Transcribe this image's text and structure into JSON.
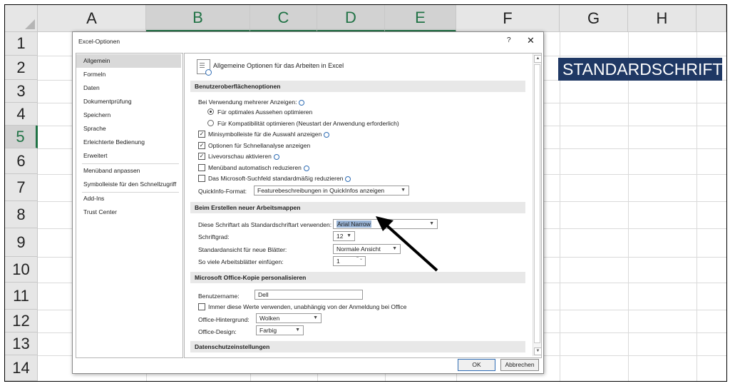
{
  "spreadsheet": {
    "columns": [
      "A",
      "B",
      "C",
      "D",
      "E",
      "F",
      "G",
      "H"
    ],
    "rows": [
      "1",
      "2",
      "3",
      "4",
      "5",
      "6",
      "7",
      "8",
      "9",
      "10",
      "11",
      "12",
      "13",
      "14"
    ],
    "cell_g2": "STANDARDSCHRIFT",
    "cell_g2_bg": "#1f3864",
    "accent": "#217346"
  },
  "dialog": {
    "title": "Excel-Optionen",
    "help": "?",
    "close": "✕",
    "nav": [
      "Allgemein",
      "Formeln",
      "Daten",
      "Dokumentprüfung",
      "Speichern",
      "Sprache",
      "Erleichterte Bedienung",
      "Erweitert",
      "Menüband anpassen",
      "Symbolleiste für den Schnellzugriff",
      "Add-Ins",
      "Trust Center"
    ],
    "header": "Allgemeine Optionen für das Arbeiten in Excel",
    "section1": {
      "title": "Benutzeroberflächenoptionen",
      "multi_display": "Bei Verwendung mehrerer Anzeigen:",
      "radio1": "Für optimales Aussehen optimieren",
      "radio2": "Für Kompatibilität optimieren (Neustart der Anwendung erforderlich)",
      "cb1": "Minisymbolleiste für die Auswahl anzeigen",
      "cb2": "Optionen für Schnellanalyse anzeigen",
      "cb3": "Livevorschau aktivieren",
      "cb4": "Menüband automatisch reduzieren",
      "cb5": "Das Microsoft-Suchfeld standardmäßig reduzieren",
      "check": "✓",
      "quickinfo_label": "QuickInfo-Format:",
      "quickinfo_value": "Featurebeschreibungen in QuickInfos anzeigen"
    },
    "section2": {
      "title": "Beim Erstellen neuer Arbeitsmappen",
      "font_label": "Diese Schriftart als Standardschriftart verwenden:",
      "font_value": "Arial Narrow",
      "size_label": "Schriftgrad:",
      "size_value": "12",
      "view_label": "Standardansicht für neue Blätter:",
      "view_value": "Normale Ansicht",
      "sheets_label": "So viele Arbeitsblätter einfügen:",
      "sheets_value": "1"
    },
    "section3": {
      "title": "Microsoft Office-Kopie personalisieren",
      "user_label": "Benutzername:",
      "user_value": "Dell",
      "always_label": "Immer diese Werte verwenden, unabhängig von der Anmeldung bei Office",
      "background_label": "Office-Hintergrund:",
      "background_value": "Wolken",
      "design_label": "Office-Design:",
      "design_value": "Farbig"
    },
    "section4": {
      "title": "Datenschutzeinstellungen"
    },
    "dropdown_arrow": "▼",
    "spin_arrows": "⌃⌄",
    "scroll_up": "▲",
    "scroll_down": "▼",
    "ok": "OK",
    "cancel": "Abbrechen"
  }
}
